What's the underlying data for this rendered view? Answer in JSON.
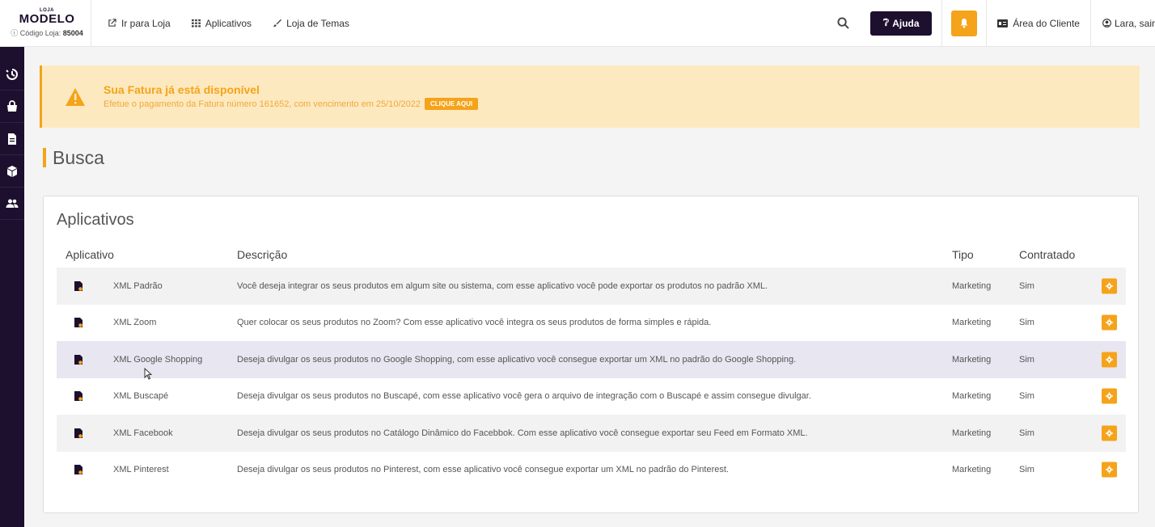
{
  "brand": {
    "small": "LOJA",
    "name": "MODELO",
    "code_label": "Código Loja:",
    "code_value": "85004"
  },
  "nav": [
    {
      "label": "Ir para Loja",
      "icon": "external-link-icon"
    },
    {
      "label": "Aplicativos",
      "icon": "grid-icon"
    },
    {
      "label": "Loja de Temas",
      "icon": "brush-icon"
    }
  ],
  "header": {
    "help_label": "Ajuda",
    "client_label": "Área do Cliente",
    "user_label": "Lara, sair"
  },
  "sidebar": {
    "icons": [
      "clock-icon",
      "bag-icon",
      "document-icon",
      "box-icon",
      "users-icon"
    ]
  },
  "alert": {
    "title": "Sua Fatura já está disponível",
    "body": "Efetue o pagamento da Fatura número 161652, com vencimento em 25/10/2022",
    "cta": "CLIQUE AQUI"
  },
  "page_title": "Busca",
  "card": {
    "title": "Aplicativos",
    "columns": [
      "Aplicativo",
      "Descrição",
      "Tipo",
      "Contratado"
    ],
    "rows": [
      {
        "name": "XML Padrão",
        "description": "Você deseja integrar os seus produtos em algum site ou sistema, com esse aplicativo você pode exportar os produtos no padrão XML.",
        "type": "Marketing",
        "hired": "Sim"
      },
      {
        "name": "XML Zoom",
        "description": "Quer colocar os seus produtos no Zoom? Com esse aplicativo você integra os seus produtos de forma simples e rápida.",
        "type": "Marketing",
        "hired": "Sim"
      },
      {
        "name": "XML Google Shopping",
        "description": "Deseja divulgar os seus produtos no Google Shopping, com esse aplicativo você consegue exportar um XML no padrão do Google Shopping.",
        "type": "Marketing",
        "hired": "Sim"
      },
      {
        "name": "XML Buscapé",
        "description": "Deseja divulgar os seus produtos no Buscapé, com esse aplicativo você gera o arquivo de integração com o Buscapé e assim consegue divulgar.",
        "type": "Marketing",
        "hired": "Sim"
      },
      {
        "name": "XML Facebook",
        "description": "Deseja divulgar os seus produtos no Catálogo Dinâmico do Facebbok. Com esse aplicativo você consegue exportar seu Feed em Formato XML.",
        "type": "Marketing",
        "hired": "Sim"
      },
      {
        "name": "XML Pinterest",
        "description": "Deseja divulgar os seus produtos no Pinterest, com esse aplicativo você consegue exportar um XML no padrão do Pinterest.",
        "type": "Marketing",
        "hired": "Sim"
      }
    ]
  },
  "colors": {
    "primary": "#1d0f2e",
    "accent": "#f5a31a",
    "alert_bg": "#fde9bf"
  }
}
